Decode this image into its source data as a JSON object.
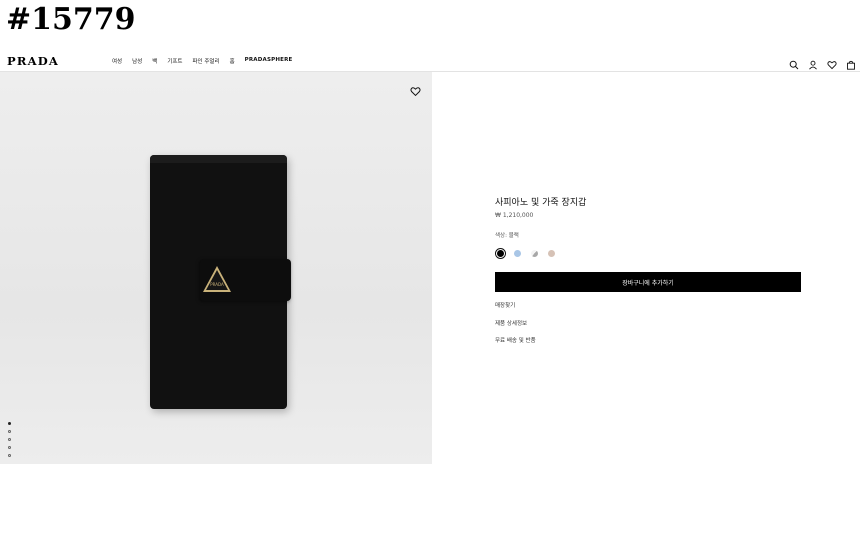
{
  "overlay_id": "#15779",
  "header": {
    "logo": "PRADA",
    "nav": [
      "여성",
      "남성",
      "백",
      "기프트",
      "파인 주얼리",
      "홈",
      "PRADASPHERE"
    ]
  },
  "icons": {
    "search": "search-icon",
    "account": "user-icon",
    "wishlist": "heart-icon",
    "cart": "bag-icon"
  },
  "product": {
    "title": "사피아노 및 가죽 장지갑",
    "price": "₩ 1,210,000",
    "color_label": "색상: 블랙",
    "swatches": [
      {
        "name": "black",
        "color": "#000000"
      },
      {
        "name": "light-blue",
        "color": "#a9c6e6"
      },
      {
        "name": "white-gray",
        "color": "#d0d0d0"
      },
      {
        "name": "beige",
        "color": "#d6c2b6"
      }
    ],
    "add_to_cart": "장바구니에 추가하기",
    "links": [
      "매장찾기",
      "제품 상세정보",
      "무료 배송 및 반품"
    ]
  },
  "gallery": {
    "image_count": 5,
    "active_index": 0
  },
  "accent_colors": {
    "button": "#000000",
    "badge": "#c9b27a"
  }
}
